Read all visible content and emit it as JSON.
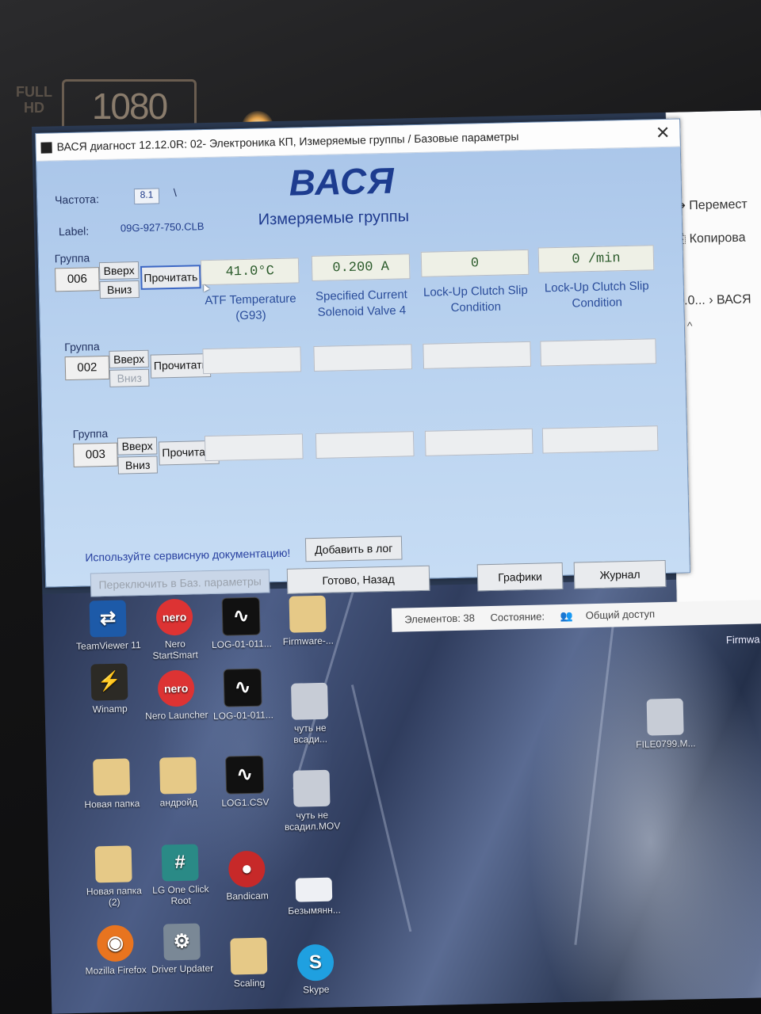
{
  "bezel": {
    "badge_left": "FULL HD",
    "badge_right": "1080"
  },
  "explorer": {
    "move_label": "Перемест",
    "copy_label": "Копирова",
    "path": "0.0...  ›  ВАСЯ",
    "status_items": "Элементов: 38",
    "status_state": "Состояние:",
    "status_share": "Общий доступ",
    "side_file": "Firmwa"
  },
  "desktop_icons": [
    {
      "label": "TeamViewer 11",
      "icon": "teamviewer-icon",
      "glyph": "⇄"
    },
    {
      "label": "Nero StartSmart",
      "icon": "nero-icon",
      "glyph": "nero"
    },
    {
      "label": "LOG-01-011...",
      "icon": "log-icon",
      "glyph": "∿"
    },
    {
      "label": "Firmware-...",
      "icon": "folder-icon",
      "glyph": ""
    },
    {
      "label": "Winamp",
      "icon": "winamp-icon",
      "glyph": "⚡"
    },
    {
      "label": "Nero Launcher",
      "icon": "nero-icon",
      "glyph": "nero"
    },
    {
      "label": "LOG-01-011...",
      "icon": "log-icon",
      "glyph": "∿"
    },
    {
      "label": "чуть не всади...",
      "icon": "video-icon",
      "glyph": ""
    },
    {
      "label": "Новая папка",
      "icon": "folder-icon",
      "glyph": ""
    },
    {
      "label": "андройд",
      "icon": "folder-icon",
      "glyph": ""
    },
    {
      "label": "LOG1.CSV",
      "icon": "log-icon",
      "glyph": "∿"
    },
    {
      "label": "чуть не всадил.MOV",
      "icon": "video-icon",
      "glyph": ""
    },
    {
      "label": "Новая папка (2)",
      "icon": "folder-icon",
      "glyph": ""
    },
    {
      "label": "LG One Click Root",
      "icon": "lg-root-icon",
      "glyph": "#"
    },
    {
      "label": "Bandicam",
      "icon": "bandicam-icon",
      "glyph": "●"
    },
    {
      "label": "Безымянн...",
      "icon": "blank-file-icon",
      "glyph": ""
    },
    {
      "label": "Mozilla Firefox",
      "icon": "firefox-icon",
      "glyph": "◉"
    },
    {
      "label": "Driver Updater",
      "icon": "driver-updater-icon",
      "glyph": "⚙"
    },
    {
      "label": "Scaling",
      "icon": "folder-icon",
      "glyph": ""
    },
    {
      "label": "Skype",
      "icon": "skype-icon",
      "glyph": "S"
    },
    {
      "label": "FILE0799.M...",
      "icon": "video-icon",
      "glyph": ""
    }
  ],
  "window": {
    "title": "ВАСЯ диагност 12.12.0R: 02- Электроника КП,  Измеряемые группы / Базовые параметры",
    "brand": "ВАСЯ",
    "subtitle": "Измеряемые группы",
    "freq_label": "Частота:",
    "freq_value": "8.1",
    "freq_mark": "\\",
    "label_label": "Label:",
    "label_value": "09G-927-750.CLB",
    "groups": [
      {
        "title": "Группа",
        "number": "006",
        "up": "Вверх",
        "down": "Вниз",
        "read": "Прочитать",
        "values": [
          "41.0°C",
          "0.200 A",
          "0",
          "0 /min"
        ],
        "labels": [
          "ATF Temperature (G93)",
          "Specified Current Solenoid Valve 4",
          "Lock-Up Clutch Slip Condition",
          "Lock-Up Clutch Slip Condition"
        ]
      },
      {
        "title": "Группа",
        "number": "002",
        "up": "Вверх",
        "down": "Вниз",
        "read": "Прочитать",
        "values": [
          "",
          "",
          "",
          ""
        ],
        "labels": [
          "",
          "",
          "",
          ""
        ]
      },
      {
        "title": "Группа",
        "number": "003",
        "up": "Вверх",
        "down": "Вниз",
        "read": "Прочитать",
        "values": [
          "",
          "",
          "",
          ""
        ],
        "labels": [
          "",
          "",
          "",
          ""
        ]
      }
    ],
    "hint": "Используйте сервисную документацию!",
    "add_log": "Добавить в лог",
    "switch_basic": "Переключить в Баз. параметры",
    "done_back": "Готово, Назад",
    "graphs": "Графики",
    "journal": "Журнал"
  }
}
